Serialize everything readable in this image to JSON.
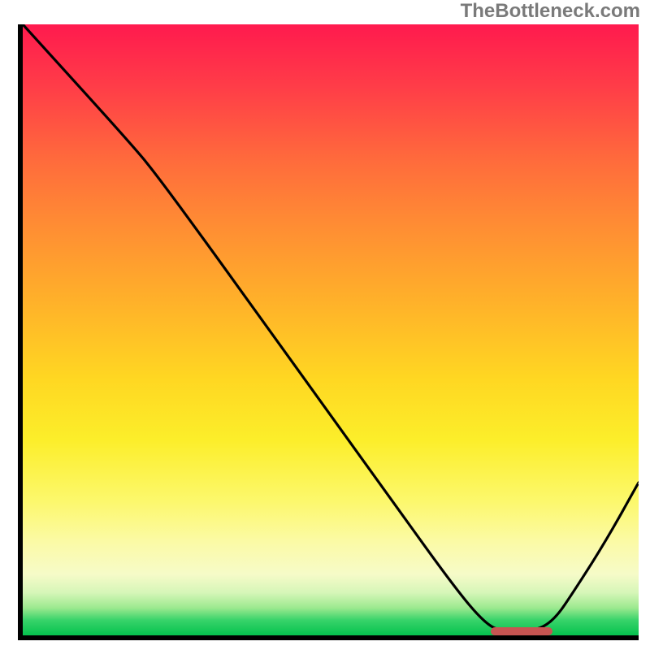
{
  "watermark": "TheBottleneck.com",
  "colors": {
    "axis": "#000000",
    "curve": "#000000",
    "marker": "#c75552",
    "gradient_top": "#ff1a4e",
    "gradient_bottom": "#05c24e"
  },
  "chart_data": {
    "type": "line",
    "title": "",
    "xlabel": "",
    "ylabel": "",
    "xlim": [
      0,
      100
    ],
    "ylim": [
      0,
      100
    ],
    "x": [
      0,
      18,
      22,
      30,
      40,
      50,
      60,
      70,
      75,
      78,
      82,
      86,
      90,
      95,
      100
    ],
    "values": [
      100,
      80,
      75,
      64,
      50,
      36,
      22,
      8,
      2,
      0.5,
      0.5,
      2,
      8,
      16,
      25
    ],
    "annotations": [
      {
        "kind": "marker-bar",
        "x_start": 76,
        "x_end": 86,
        "y": 0.6,
        "color": "#c75552"
      }
    ]
  }
}
